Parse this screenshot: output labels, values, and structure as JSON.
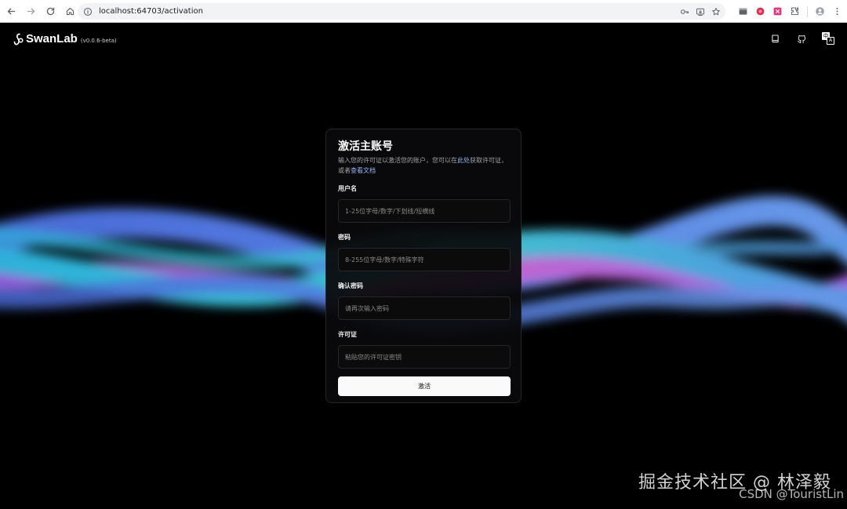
{
  "browser": {
    "url": "localhost:64703/activation",
    "icons": [
      "back-icon",
      "forward-icon",
      "reload-icon",
      "home-icon",
      "site-info-icon",
      "password-key-icon",
      "install-app-icon",
      "bookmark-star-icon",
      "extensions-icon",
      "profile-icon",
      "menu-icon"
    ]
  },
  "header": {
    "brand": "SwanLab",
    "version": "(v0.0.6-beta)",
    "lang_zh": "中",
    "lang_en": "A"
  },
  "card": {
    "title": "激活主账号",
    "desc_before": "输入您的许可证以激活您的账户，您可以在",
    "desc_link_here": "此处",
    "desc_middle": "获取许可证，或者",
    "desc_link_docs": "查看文档",
    "fields": [
      {
        "label": "用户名",
        "placeholder": "1-25位字母/数字/下划线/短横线",
        "value": ""
      },
      {
        "label": "密码",
        "placeholder": "8-255位字母/数字/特殊字符",
        "value": ""
      },
      {
        "label": "确认密码",
        "placeholder": "请再次输入密码",
        "value": ""
      },
      {
        "label": "许可证",
        "placeholder": "粘贴您的许可证密钥",
        "value": ""
      }
    ],
    "submit_label": "激活"
  },
  "watermark": {
    "line1": "掘金技术社区 @ 林泽毅",
    "line2": "CSDN @TouristLin"
  },
  "colors": {
    "background": "#000000",
    "card_bg": "#0a0a0c",
    "link": "#93b4f5",
    "button_bg": "#fafafa",
    "wave_cyan": "#2fc7e0",
    "wave_violet": "#b763e6",
    "wave_blue": "#5a86f0"
  }
}
